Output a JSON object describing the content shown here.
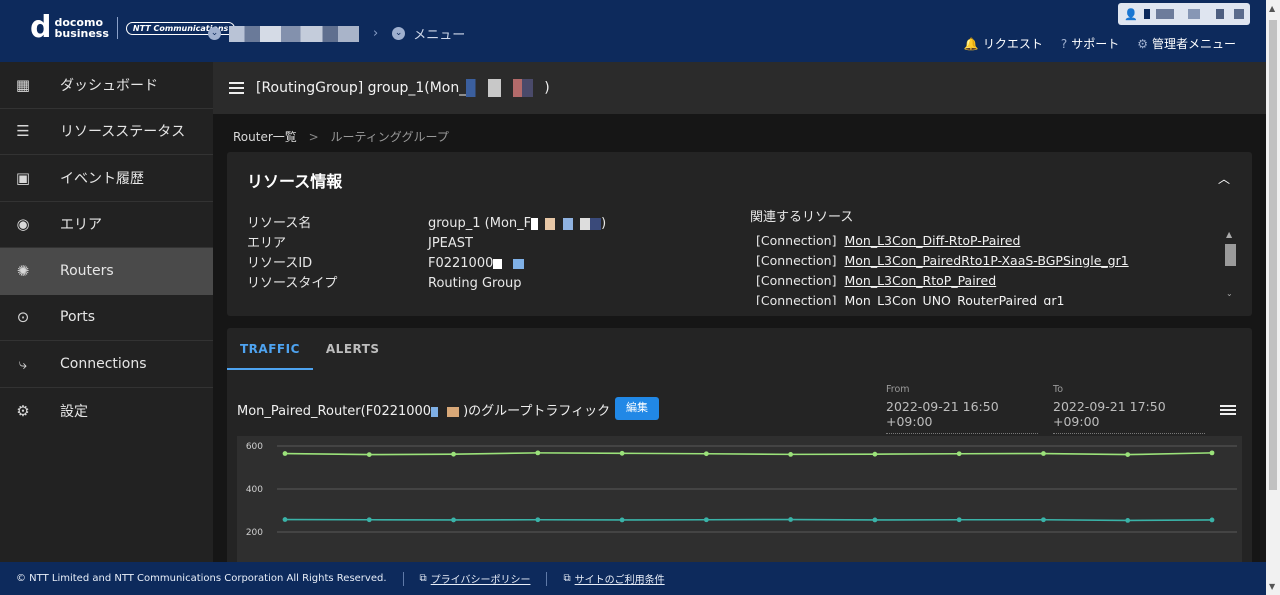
{
  "header": {
    "logo_main": "docomo business",
    "logo_word1": "docomo",
    "logo_word2": "business",
    "logo_sub": "NTT Communications",
    "crumb_menu": "メニュー",
    "links": [
      {
        "label": "リクエスト",
        "icon": "bell-icon"
      },
      {
        "label": "サポート",
        "icon": "help-icon"
      },
      {
        "label": "管理者メニュー",
        "icon": "gear-icon"
      }
    ]
  },
  "sidebar": {
    "items": [
      {
        "label": "ダッシュボード",
        "icon": "grid-icon"
      },
      {
        "label": "リソースステータス",
        "icon": "status-list-icon"
      },
      {
        "label": "イベント履歴",
        "icon": "calendar-icon"
      },
      {
        "label": "エリア",
        "icon": "globe-icon"
      },
      {
        "label": "Routers",
        "icon": "router-icon",
        "active": true
      },
      {
        "label": "Ports",
        "icon": "ports-icon"
      },
      {
        "label": "Connections",
        "icon": "connections-icon"
      },
      {
        "label": "設定",
        "icon": "gear-icon"
      }
    ]
  },
  "main": {
    "title_prefix": "[RoutingGroup] group_1(Mon_",
    "title_suffix": ")",
    "breadcrumb": [
      "Router一覧",
      "ルーティンググループ"
    ],
    "breadcrumb_sep": ">"
  },
  "resource": {
    "title": "リソース情報",
    "fields": [
      {
        "key": "リソース名",
        "value": "group_1 (Mon_F",
        "value_suffix": ")"
      },
      {
        "key": "エリア",
        "value": "JPEAST"
      },
      {
        "key": "リソースID",
        "value": "F0221000"
      },
      {
        "key": "リソースタイプ",
        "value": "Routing Group"
      }
    ],
    "related_label": "関連するリソース",
    "related": [
      {
        "tag": "[Connection]",
        "name": "Mon_L3Con_Diff-RtoP-Paired"
      },
      {
        "tag": "[Connection]",
        "name": "Mon_L3Con_PairedRto1P-XaaS-BGPSingle_gr1"
      },
      {
        "tag": "[Connection]",
        "name": "Mon_L3Con_RtoP_Paired"
      },
      {
        "tag": "[Connection]",
        "name": "Mon_L3Con_UNO_RouterPaired_gr1"
      }
    ]
  },
  "traffic": {
    "tabs": [
      "TRAFFIC",
      "ALERTS"
    ],
    "title_prefix": "Mon_Paired_Router(F0221000",
    "title_suffix": ")のグループトラフィック",
    "edit_label": "編集",
    "from_label": "From",
    "from_value": "2022-09-21 16:50 +09:00",
    "to_label": "To",
    "to_value": "2022-09-21 17:50 +09:00"
  },
  "chart_data": {
    "type": "line",
    "yticks": [
      600,
      400,
      200
    ],
    "ylim": [
      130,
      620
    ],
    "x": [
      1,
      2,
      3,
      4,
      5,
      6,
      7,
      8,
      9,
      10,
      11,
      12
    ],
    "series": [
      {
        "color": "#9be27a",
        "values": [
          565,
          560,
          562,
          568,
          566,
          564,
          561,
          562,
          564,
          565,
          560,
          568
        ]
      },
      {
        "color": "#3ab3a8",
        "values": [
          258,
          257,
          256,
          257,
          256,
          257,
          258,
          256,
          257,
          257,
          254,
          256
        ]
      }
    ]
  },
  "footer": {
    "copyright": "© NTT Limited and NTT Communications Corporation All Rights Reserved.",
    "links": [
      "プライバシーポリシー",
      "サイトのご利用条件"
    ]
  }
}
